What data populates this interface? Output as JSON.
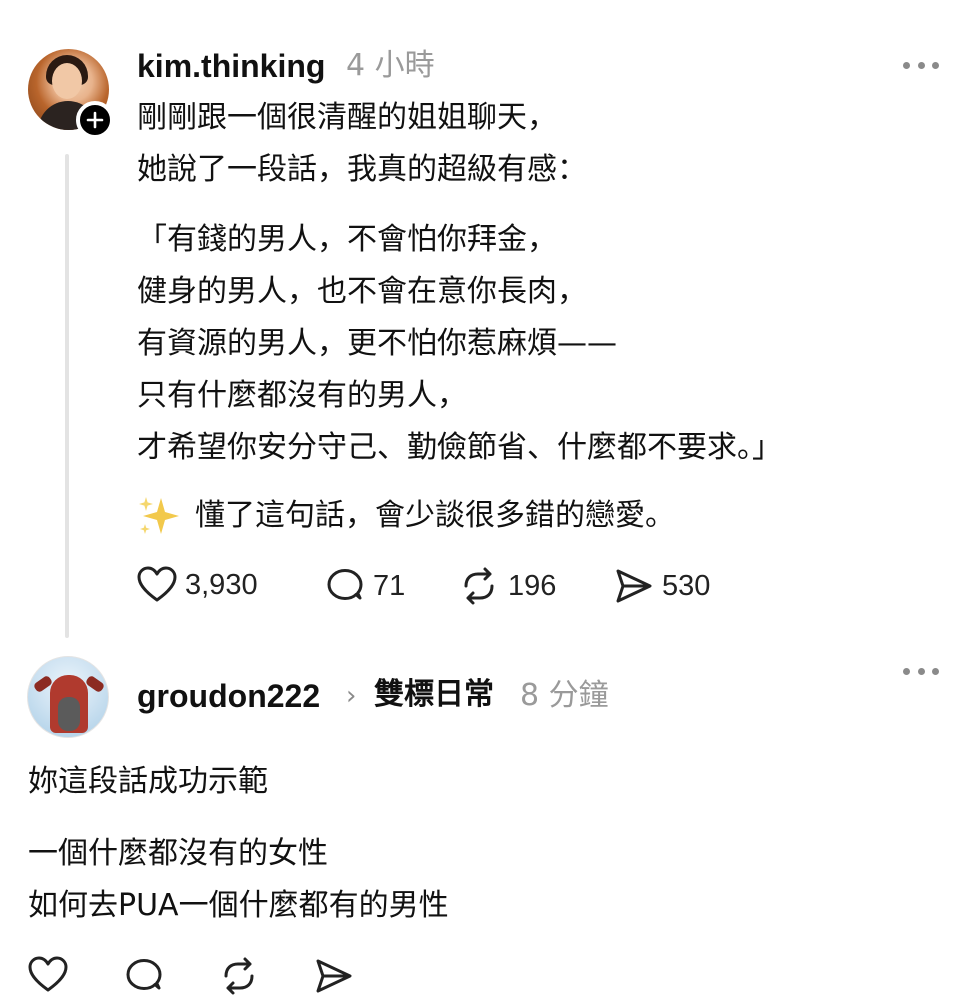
{
  "post": {
    "username": "kim.thinking",
    "time": "4 小時",
    "lines_intro": [
      "剛剛跟一個很清醒的姐姐聊天，",
      "她說了一段話，我真的超級有感："
    ],
    "lines_quote": [
      "「有錢的男人，不會怕你拜金，",
      "健身的男人，也不會在意你長肉，",
      "有資源的男人，更不怕你惹麻煩——",
      "只有什麼都沒有的男人，",
      "才希望你安分守己、勤儉節省、什麼都不要求。」"
    ],
    "line_outro": "懂了這句話，會少談很多錯的戀愛。",
    "actions": {
      "likes": "3,930",
      "comments": "71",
      "reposts": "196",
      "shares": "530"
    }
  },
  "reply": {
    "username": "groudon222",
    "topic": "雙標日常",
    "time": "8 分鐘",
    "lines_first": [
      "妳這段話成功示範"
    ],
    "lines_second": [
      "一個什麼都沒有的女性",
      "如何去PUA一個什麼都有的男性"
    ]
  },
  "icons": {
    "more": "more-horizontal-icon",
    "follow": "plus-icon",
    "like": "heart-icon",
    "comment": "comment-icon",
    "repost": "repost-icon",
    "share": "send-icon",
    "sparkles": "sparkles-icon",
    "topic_chevron": "chevron-right-icon"
  },
  "colors": {
    "text": "#111111",
    "muted": "#9a9a9a",
    "thread_line": "#e3e3e3",
    "sparkle": "#f2c94c"
  }
}
